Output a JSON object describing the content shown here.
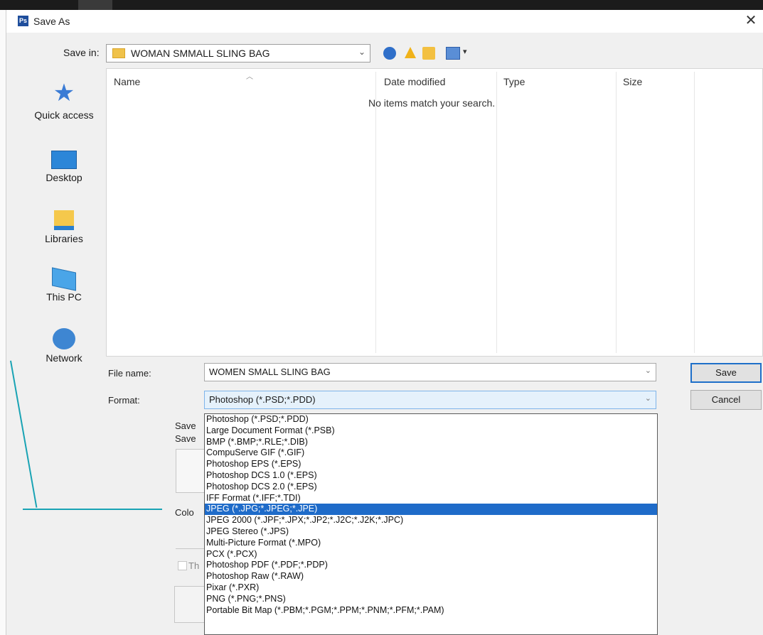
{
  "dialog": {
    "title": "Save As",
    "app_icon": "Ps",
    "close_glyph": "✕"
  },
  "save_in": {
    "label": "Save in:",
    "value": "WOMAN SMMALL SLING BAG"
  },
  "places": [
    {
      "label": "Quick access",
      "icon": "star-icon"
    },
    {
      "label": "Desktop",
      "icon": "desktop-icon"
    },
    {
      "label": "Libraries",
      "icon": "libraries-icon"
    },
    {
      "label": "This PC",
      "icon": "computer-icon"
    },
    {
      "label": "Network",
      "icon": "network-icon"
    }
  ],
  "file_list": {
    "columns": {
      "name": "Name",
      "date_modified": "Date modified",
      "type": "Type",
      "size": "Size"
    },
    "empty_message": "No items match your search."
  },
  "file_name": {
    "label": "File name:",
    "value": "WOMEN SMALL SLING BAG"
  },
  "format": {
    "label": "Format:",
    "value": "Photoshop (*.PSD;*.PDD)",
    "options": [
      "Photoshop (*.PSD;*.PDD)",
      "Large Document Format (*.PSB)",
      "BMP (*.BMP;*.RLE;*.DIB)",
      "CompuServe GIF (*.GIF)",
      "Photoshop EPS (*.EPS)",
      "Photoshop DCS 1.0 (*.EPS)",
      "Photoshop DCS 2.0 (*.EPS)",
      "IFF Format (*.IFF;*.TDI)",
      "JPEG (*.JPG;*.JPEG;*.JPE)",
      "JPEG 2000 (*.JPF;*.JPX;*.JP2;*.J2C;*.J2K;*.JPC)",
      "JPEG Stereo (*.JPS)",
      "Multi-Picture Format (*.MPO)",
      "PCX (*.PCX)",
      "Photoshop PDF (*.PDF;*.PDP)",
      "Photoshop Raw (*.RAW)",
      "Pixar (*.PXR)",
      "PNG (*.PNG;*.PNS)",
      "Portable Bit Map (*.PBM;*.PGM;*.PPM;*.PNM;*.PFM;*.PAM)"
    ],
    "highlighted_index": 8
  },
  "buttons": {
    "save": "Save",
    "cancel": "Cancel"
  },
  "obscured_labels": {
    "save_opts_1": "Save",
    "save_opts_2": "Save",
    "color": "Colo",
    "thumbnail": "Th"
  },
  "colors": {
    "highlight": "#1e6bc9",
    "callout": "#19a3b4",
    "dialog_bg": "#f0f0f0"
  }
}
